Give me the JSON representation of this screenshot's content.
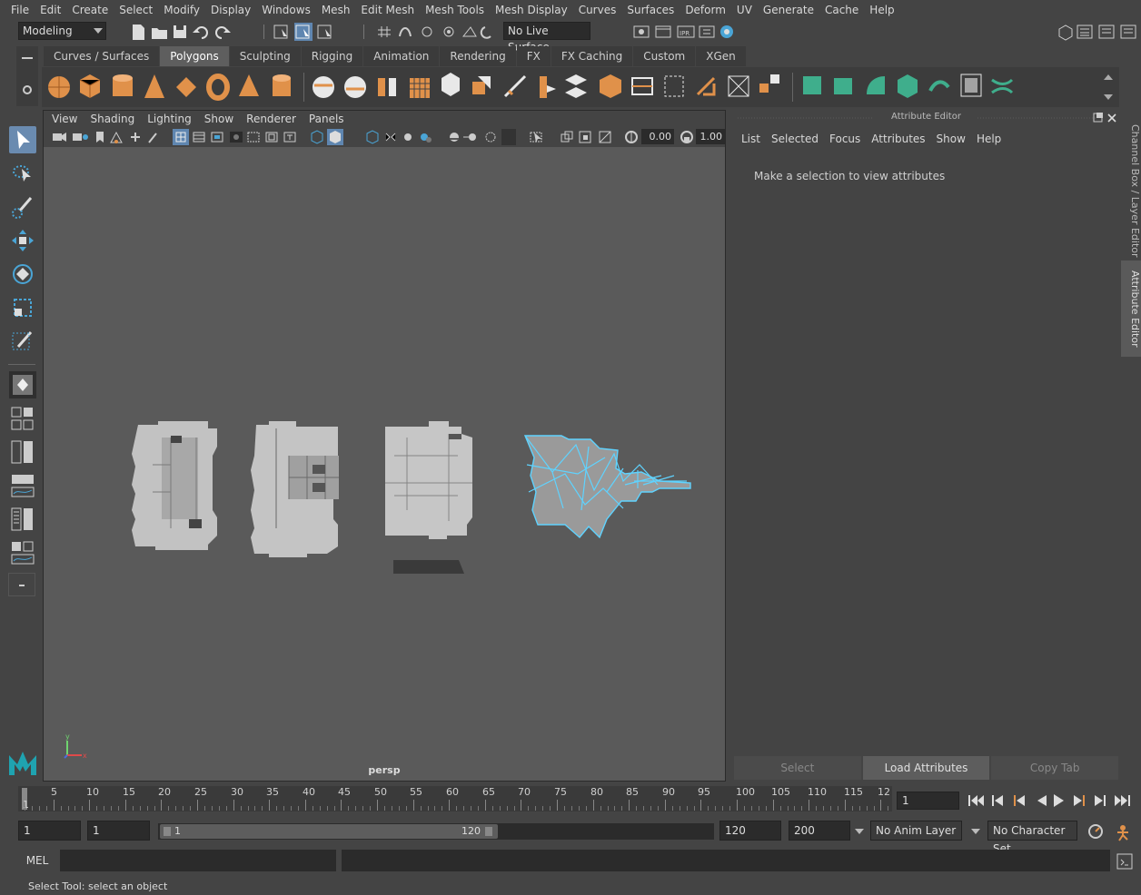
{
  "menubar": [
    "File",
    "Edit",
    "Create",
    "Select",
    "Modify",
    "Display",
    "Windows",
    "Mesh",
    "Edit Mesh",
    "Mesh Tools",
    "Mesh Display",
    "Curves",
    "Surfaces",
    "Deform",
    "UV",
    "Generate",
    "Cache",
    "Help"
  ],
  "statusline": {
    "menuset": "Modeling",
    "live_surface": "No Live Surface"
  },
  "shelf": {
    "tabs": [
      "Curves / Surfaces",
      "Polygons",
      "Sculpting",
      "Rigging",
      "Animation",
      "Rendering",
      "FX",
      "FX Caching",
      "Custom",
      "XGen"
    ],
    "active_tab": "Polygons",
    "icon_colors": {
      "orange": "#e0914a",
      "white": "#e8e8e8",
      "teal": "#3fae8c",
      "panel": "#3c3c3c"
    }
  },
  "viewport": {
    "menu": [
      "View",
      "Shading",
      "Lighting",
      "Show",
      "Renderer",
      "Panels"
    ],
    "exposure": "0.00",
    "gamma": "1.00",
    "camera": "persp",
    "selection_color": "#5fd3ff",
    "axis": {
      "x": "x",
      "y": "y"
    }
  },
  "attribute_editor": {
    "title": "Attribute Editor",
    "menu": [
      "List",
      "Selected",
      "Focus",
      "Attributes",
      "Show",
      "Help"
    ],
    "message": "Make a selection to view attributes",
    "buttons": [
      "Select",
      "Load Attributes",
      "Copy Tab"
    ],
    "active_button": "Load Attributes",
    "side_tabs": [
      "Channel Box / Layer Editor",
      "Attribute Editor"
    ]
  },
  "timeslider": {
    "labels": [
      "5",
      "10",
      "15",
      "20",
      "25",
      "30",
      "35",
      "40",
      "45",
      "50",
      "55",
      "60",
      "65",
      "70",
      "75",
      "80",
      "85",
      "90",
      "95",
      "100",
      "105",
      "110",
      "115",
      "12"
    ],
    "start_label": "1",
    "current_frame": "1"
  },
  "range": {
    "start": "1",
    "playback_start": "1",
    "handle_start": "1",
    "handle_end": "120",
    "playback_end": "120",
    "end": "200",
    "anim_layer": "No Anim Layer",
    "character_set": "No Character Set"
  },
  "commandline": {
    "mode": "MEL",
    "help": "Select Tool: select an object"
  }
}
